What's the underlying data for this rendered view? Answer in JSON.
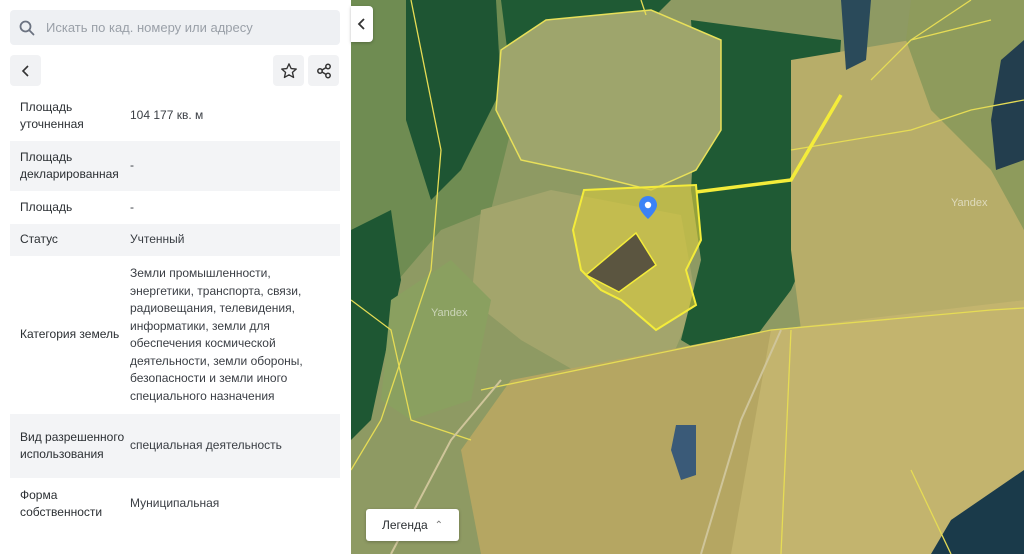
{
  "search": {
    "placeholder": "Искать по кад. номеру или адресу"
  },
  "toolbar": {
    "back_icon": "arrow-left-icon",
    "favorite_icon": "star-icon",
    "share_icon": "share-icon"
  },
  "details": [
    {
      "label": "Площадь уточненная",
      "value": "104 177 кв. м"
    },
    {
      "label": "Площадь декларированная",
      "value": "-"
    },
    {
      "label": "Площадь",
      "value": "-"
    },
    {
      "label": "Статус",
      "value": "Учтенный"
    },
    {
      "label": "Категория земель",
      "value": "Земли промышленности, энергетики, транспорта, связи, радиовещания, телевидения, информатики, земли для обеспечения космической деятельности, земли обороны, безопасности и земли иного специального назначения"
    },
    {
      "label": "Вид разрешенного использования",
      "value": "специальная деятельность"
    },
    {
      "label": "Форма собственности",
      "value": "Муниципальная"
    }
  ],
  "map": {
    "legend_label": "Легенда",
    "watermark": "Yandex",
    "marker_icon": "location-pin-icon",
    "colors": {
      "forest": "#1f5a34",
      "field": "#9aa06a",
      "boundary": "#f0e54a",
      "marker": "#3b82f6",
      "water": "#1a3a4a"
    }
  }
}
